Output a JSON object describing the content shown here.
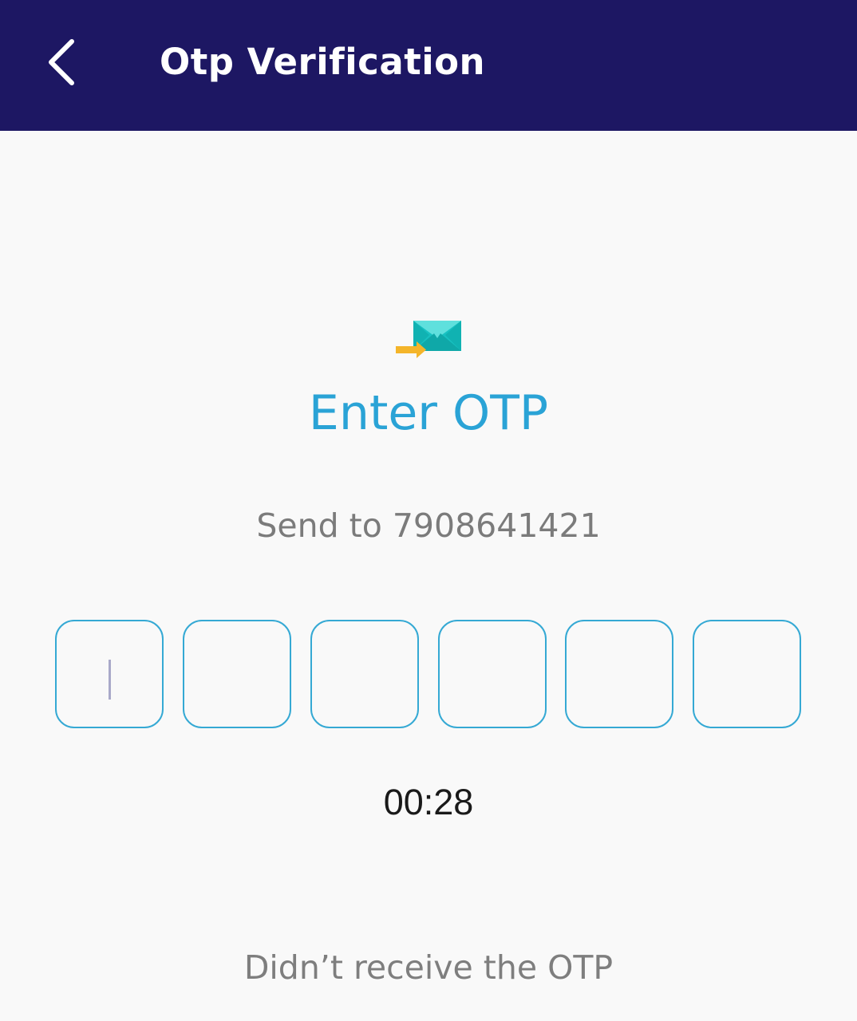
{
  "header": {
    "title": "Otp Verification",
    "back_icon": "chevron-left-icon",
    "background": "#1d1763"
  },
  "main": {
    "icon": "send-mail-icon",
    "heading": "Enter OTP",
    "sent_to": "Send to 7908641421",
    "otp_digits": [
      "",
      "",
      "",
      "",
      "",
      ""
    ],
    "timer": "00:28",
    "resend_prompt": "Didn’t receive the OTP",
    "accent_color": "#2aa3d6"
  }
}
